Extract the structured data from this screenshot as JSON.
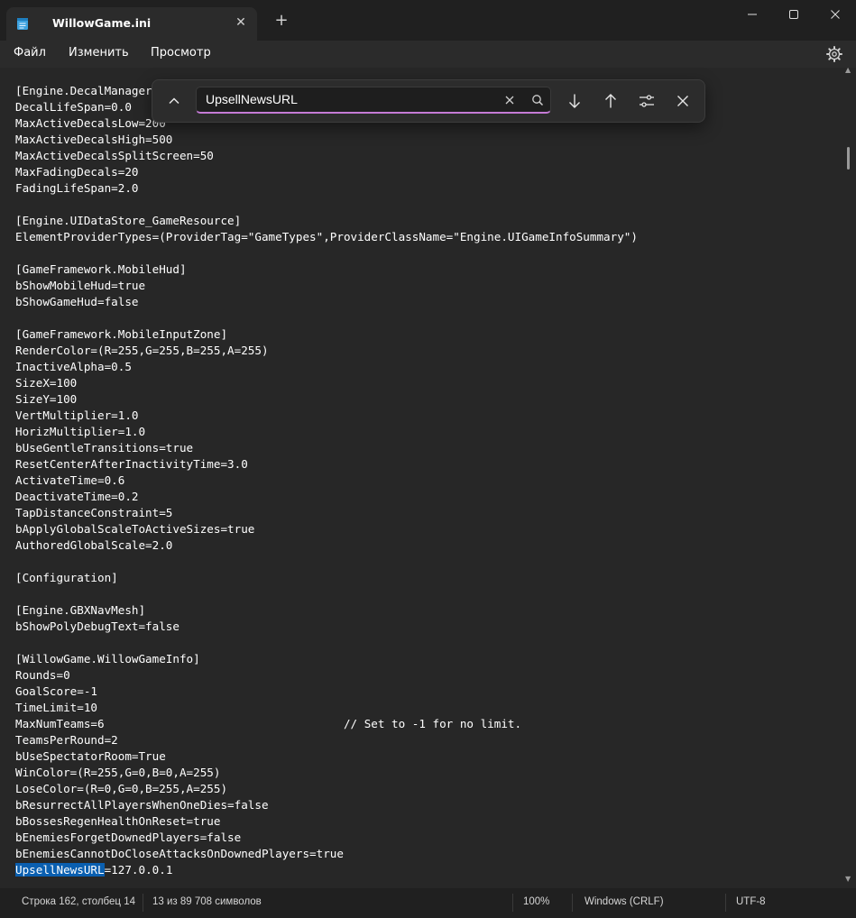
{
  "window": {
    "tab_title": "WillowGame.ini",
    "icons": {
      "app": "notepad-icon",
      "tab_close": "close-icon",
      "new_tab": "plus-icon",
      "minimize": "minimize-icon",
      "maximize": "maximize-icon",
      "close": "close-icon"
    }
  },
  "menu": {
    "file": "Файл",
    "edit": "Изменить",
    "view": "Просмотр",
    "settings_icon": "gear-icon"
  },
  "find": {
    "value": "UpsellNewsURL",
    "icons": [
      "chevron-up-icon",
      "clear-icon",
      "search-icon",
      "arrow-down-icon",
      "arrow-up-icon",
      "options-icon",
      "close-icon"
    ]
  },
  "editor": {
    "lines": [
      "[Engine.DecalManager]",
      "DecalLifeSpan=0.0",
      "MaxActiveDecalsLow=200",
      "MaxActiveDecalsHigh=500",
      "MaxActiveDecalsSplitScreen=50",
      "MaxFadingDecals=20",
      "FadingLifeSpan=2.0",
      "",
      "[Engine.UIDataStore_GameResource]",
      "ElementProviderTypes=(ProviderTag=\"GameTypes\",ProviderClassName=\"Engine.UIGameInfoSummary\")",
      "",
      "[GameFramework.MobileHud]",
      "bShowMobileHud=true",
      "bShowGameHud=false",
      "",
      "[GameFramework.MobileInputZone]",
      "RenderColor=(R=255,G=255,B=255,A=255)",
      "InactiveAlpha=0.5",
      "SizeX=100",
      "SizeY=100",
      "VertMultiplier=1.0",
      "HorizMultiplier=1.0",
      "bUseGentleTransitions=true",
      "ResetCenterAfterInactivityTime=3.0",
      "ActivateTime=0.6",
      "DeactivateTime=0.2",
      "TapDistanceConstraint=5",
      "bApplyGlobalScaleToActiveSizes=true",
      "AuthoredGlobalScale=2.0",
      "",
      "[Configuration]",
      "",
      "[Engine.GBXNavMesh]",
      "bShowPolyDebugText=false",
      "",
      "[WillowGame.WillowGameInfo]",
      "Rounds=0",
      "GoalScore=-1",
      "TimeLimit=10",
      "MaxNumTeams=6",
      "TeamsPerRound=2",
      "bUseSpectatorRoom=True",
      "WinColor=(R=255,G=0,B=0,A=255)",
      "LoseColor=(R=0,G=0,B=255,A=255)",
      "bResurrectAllPlayersWhenOneDies=false",
      "bBossesRegenHealthOnReset=true",
      "bEnemiesForgetDownedPlayers=false",
      "bEnemiesCannotDoCloseAttacksOnDownedPlayers=true"
    ],
    "comment_line_index": 39,
    "comment_text": "// Set to -1 for no limit.",
    "last_line_match": "UpsellNewsURL",
    "last_line_rest": "=127.0.0.1"
  },
  "status": {
    "position": "Строка 162, столбец 14",
    "selection": "13 из 89 708 символов",
    "zoom": "100%",
    "line_ending": "Windows (CRLF)",
    "encoding": "UTF-8"
  },
  "colors": {
    "background": "#202020",
    "editor": "#272727",
    "highlight": "#0a5fb0",
    "find_accent": "#c57bd6"
  }
}
